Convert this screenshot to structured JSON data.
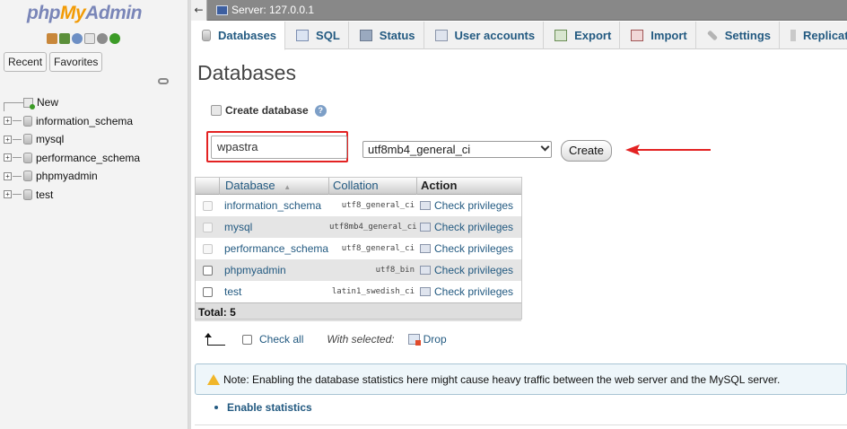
{
  "nav": {
    "logo": {
      "php": "php",
      "my": "My",
      "admin": "Admin"
    },
    "tabs": [
      "Recent",
      "Favorites"
    ],
    "tree": [
      "New",
      "information_schema",
      "mysql",
      "performance_schema",
      "phpmyadmin",
      "test"
    ]
  },
  "topbar": {
    "server_label": "Server: 127.0.0.1"
  },
  "tabs": [
    "Databases",
    "SQL",
    "Status",
    "User accounts",
    "Export",
    "Import",
    "Settings",
    "Replication"
  ],
  "page": {
    "title": "Databases",
    "create_label": "Create database",
    "db_name_value": "wpastra",
    "collation_value": "utf8mb4_general_ci",
    "create_button": "Create"
  },
  "table": {
    "headers": {
      "database": "Database",
      "collation": "Collation",
      "action": "Action"
    },
    "rows": [
      {
        "name": "information_schema",
        "collation": "utf8_general_ci",
        "action": "Check privileges"
      },
      {
        "name": "mysql",
        "collation": "utf8mb4_general_ci",
        "action": "Check privileges"
      },
      {
        "name": "performance_schema",
        "collation": "utf8_general_ci",
        "action": "Check privileges"
      },
      {
        "name": "phpmyadmin",
        "collation": "utf8_bin",
        "action": "Check privileges"
      },
      {
        "name": "test",
        "collation": "latin1_swedish_ci",
        "action": "Check privileges"
      }
    ],
    "total": "Total: 5"
  },
  "with_selected": {
    "check_all": "Check all",
    "label": "With selected:",
    "drop": "Drop"
  },
  "notice": "Note: Enabling the database statistics here might cause heavy traffic between the web server and the MySQL server.",
  "enable_stats": "Enable statistics",
  "colors": {
    "link": "#235a81",
    "highlight_box": "#e32222",
    "arrow": "#e32222"
  }
}
